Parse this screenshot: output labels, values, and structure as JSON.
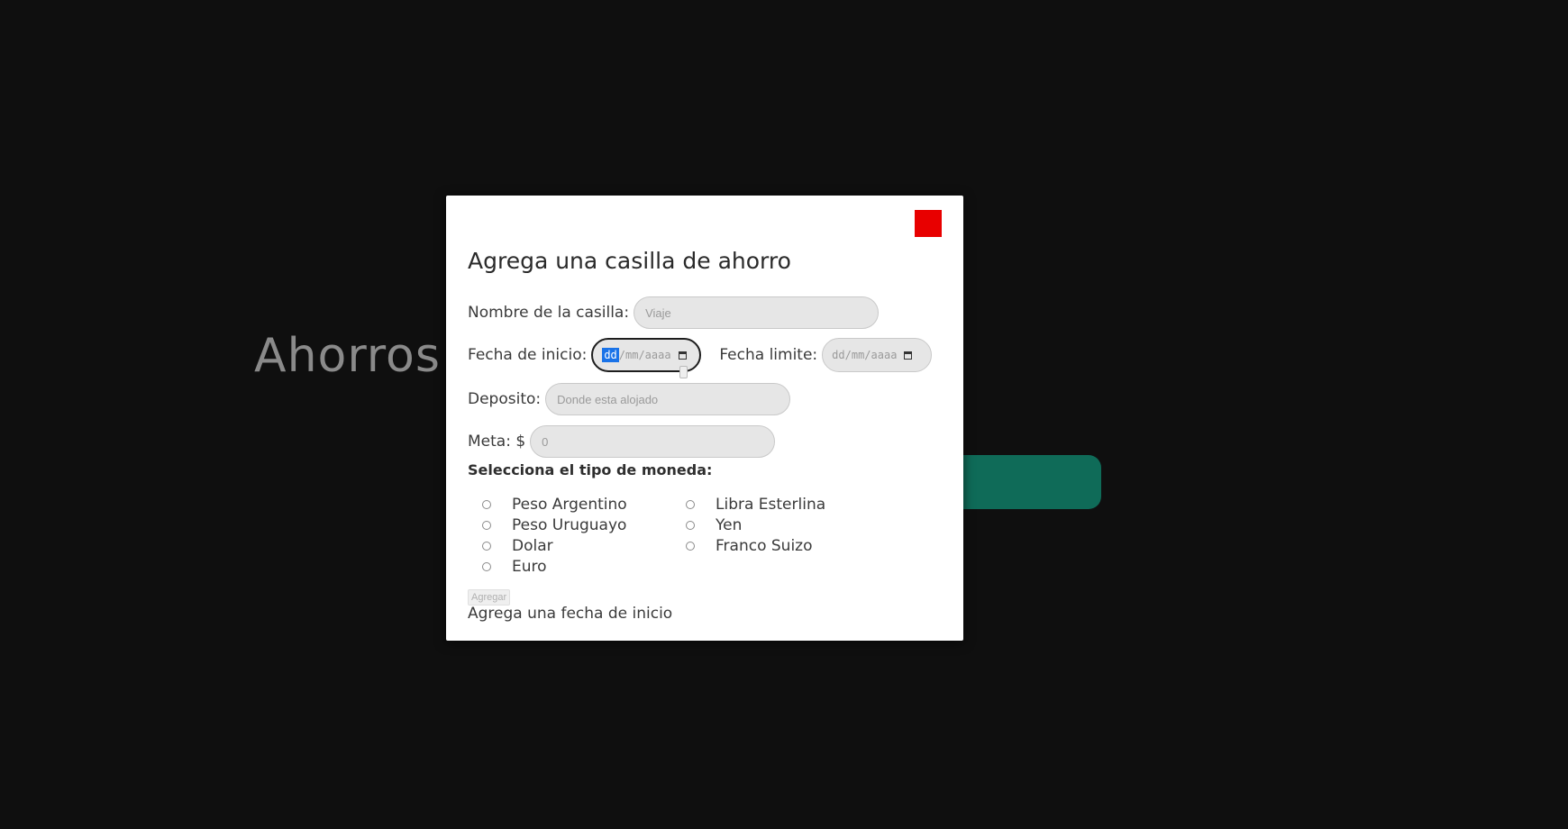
{
  "background": {
    "title": "Ahorros",
    "accent_color": "#0f6b58"
  },
  "modal": {
    "close_icon": "close-icon",
    "close_color": "#e80000",
    "title": "Agrega una casilla de ahorro",
    "fields": {
      "nombre": {
        "label": "Nombre de la casilla:",
        "placeholder": "Viaje"
      },
      "fecha_inicio": {
        "label": "Fecha de inicio:",
        "dd": "dd",
        "rest": "/mm/aaaa"
      },
      "fecha_limite": {
        "label": "Fecha limite:",
        "display": "dd/mm/aaaa"
      },
      "deposito": {
        "label": "Deposito:",
        "placeholder": "Donde esta alojado"
      },
      "meta": {
        "label": "Meta: $",
        "placeholder": "0"
      }
    },
    "currency_label": "Selecciona el tipo de moneda:",
    "currencies_col1": [
      "Peso Argentino",
      "Peso Uruguayo",
      "Dolar",
      "Euro"
    ],
    "currencies_col2": [
      "Libra Esterlina",
      "Yen",
      "Franco Suizo"
    ],
    "submit_label": "Agregar",
    "message": "Agrega una fecha de inicio"
  }
}
